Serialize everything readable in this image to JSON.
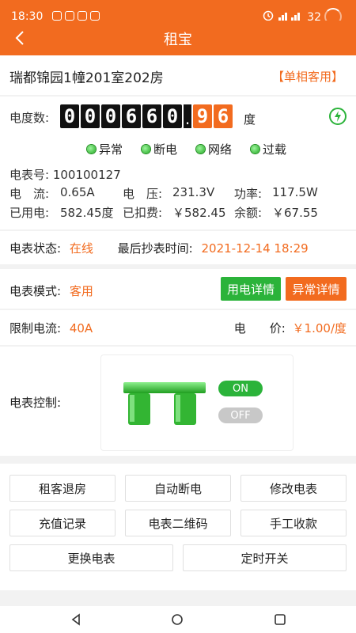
{
  "status_bar": {
    "time": "18:30",
    "battery": "32"
  },
  "header": {
    "title": "租宝"
  },
  "room": {
    "name": "瑞都锦园1幢201室202房",
    "type": "【单相客用】"
  },
  "meter": {
    "reading_label": "电度数:",
    "digits": [
      "0",
      "0",
      "0",
      "6",
      "6",
      "0"
    ],
    "decimals": [
      "9",
      "6"
    ],
    "unit": "度",
    "indicators": [
      "异常",
      "断电",
      "网络",
      "过载"
    ],
    "meter_no_label": "电表号:",
    "meter_no": "100100127",
    "current_label": "电　流:",
    "current": "0.65A",
    "voltage_label": "电　压:",
    "voltage": "231.3V",
    "power_label": "功率:",
    "power": "117.5W",
    "used_label": "已用电:",
    "used": "582.45度",
    "deducted_label": "已扣费:",
    "deducted": "￥582.45",
    "balance_label": "余额:",
    "balance": "￥67.55"
  },
  "status": {
    "label": "电表状态:",
    "value": "在线",
    "last_read_label": "最后抄表时间:",
    "last_read": "2021-12-14 18:29"
  },
  "mode": {
    "label": "电表模式:",
    "value": "客用",
    "usage_detail": "用电详情",
    "abnormal_detail": "异常详情"
  },
  "limit": {
    "label": "限制电流:",
    "value": "40A",
    "price_label": "电　　价:",
    "price": "￥1.00/度"
  },
  "control": {
    "label": "电表控制:",
    "on": "ON",
    "off": "OFF"
  },
  "actions": [
    "租客退房",
    "自动断电",
    "修改电表",
    "充值记录",
    "电表二维码",
    "手工收款",
    "更换电表",
    "定时开关"
  ]
}
